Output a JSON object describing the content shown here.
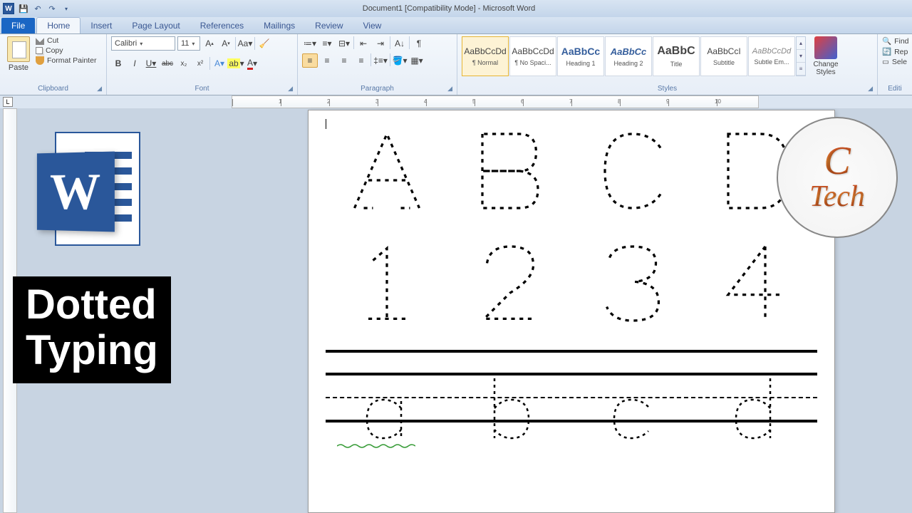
{
  "titlebar": {
    "title": "Document1 [Compatibility Mode] - Microsoft Word"
  },
  "tabs": {
    "file": "File",
    "items": [
      "Home",
      "Insert",
      "Page Layout",
      "References",
      "Mailings",
      "Review",
      "View"
    ],
    "active": "Home"
  },
  "clipboard": {
    "paste": "Paste",
    "cut": "Cut",
    "copy": "Copy",
    "format_painter": "Format Painter",
    "label": "Clipboard"
  },
  "font": {
    "name": "Calibri",
    "size": "11",
    "label": "Font"
  },
  "paragraph": {
    "label": "Paragraph"
  },
  "styles": {
    "items": [
      {
        "preview": "AaBbCcDd",
        "name": "¶ Normal",
        "selected": true,
        "pstyle": "font-size:12px;"
      },
      {
        "preview": "AaBbCcDd",
        "name": "¶ No Spaci...",
        "pstyle": "font-size:12px;"
      },
      {
        "preview": "AaBbCc",
        "name": "Heading 1",
        "pstyle": "font-size:14px;font-weight:bold;color:#355e9c;"
      },
      {
        "preview": "AaBbCc",
        "name": "Heading 2",
        "pstyle": "font-size:13px;font-weight:bold;font-style:italic;color:#355e9c;"
      },
      {
        "preview": "AaBbC",
        "name": "Title",
        "pstyle": "font-size:16px;font-weight:bold;"
      },
      {
        "preview": "AaBbCcI",
        "name": "Subtitle",
        "pstyle": "font-size:12px;"
      },
      {
        "preview": "AaBbCcDd",
        "name": "Subtle Em...",
        "pstyle": "font-size:11px;font-style:italic;color:#888;"
      }
    ],
    "change": "Change Styles",
    "label": "Styles"
  },
  "editing": {
    "find": "Find",
    "replace": "Rep",
    "select": "Sele",
    "label": "Editi"
  },
  "document": {
    "row1": [
      "A",
      "B",
      "C",
      "D"
    ],
    "row2": [
      "1",
      "2",
      "3",
      "4"
    ],
    "row3": [
      "a",
      "b",
      "c",
      "d"
    ]
  },
  "overlays": {
    "word_logo_letter": "W",
    "dotted_text_l1": "Dotted",
    "dotted_text_l2": "Typing",
    "ctech_l1": "C",
    "ctech_l2": "Tech"
  }
}
